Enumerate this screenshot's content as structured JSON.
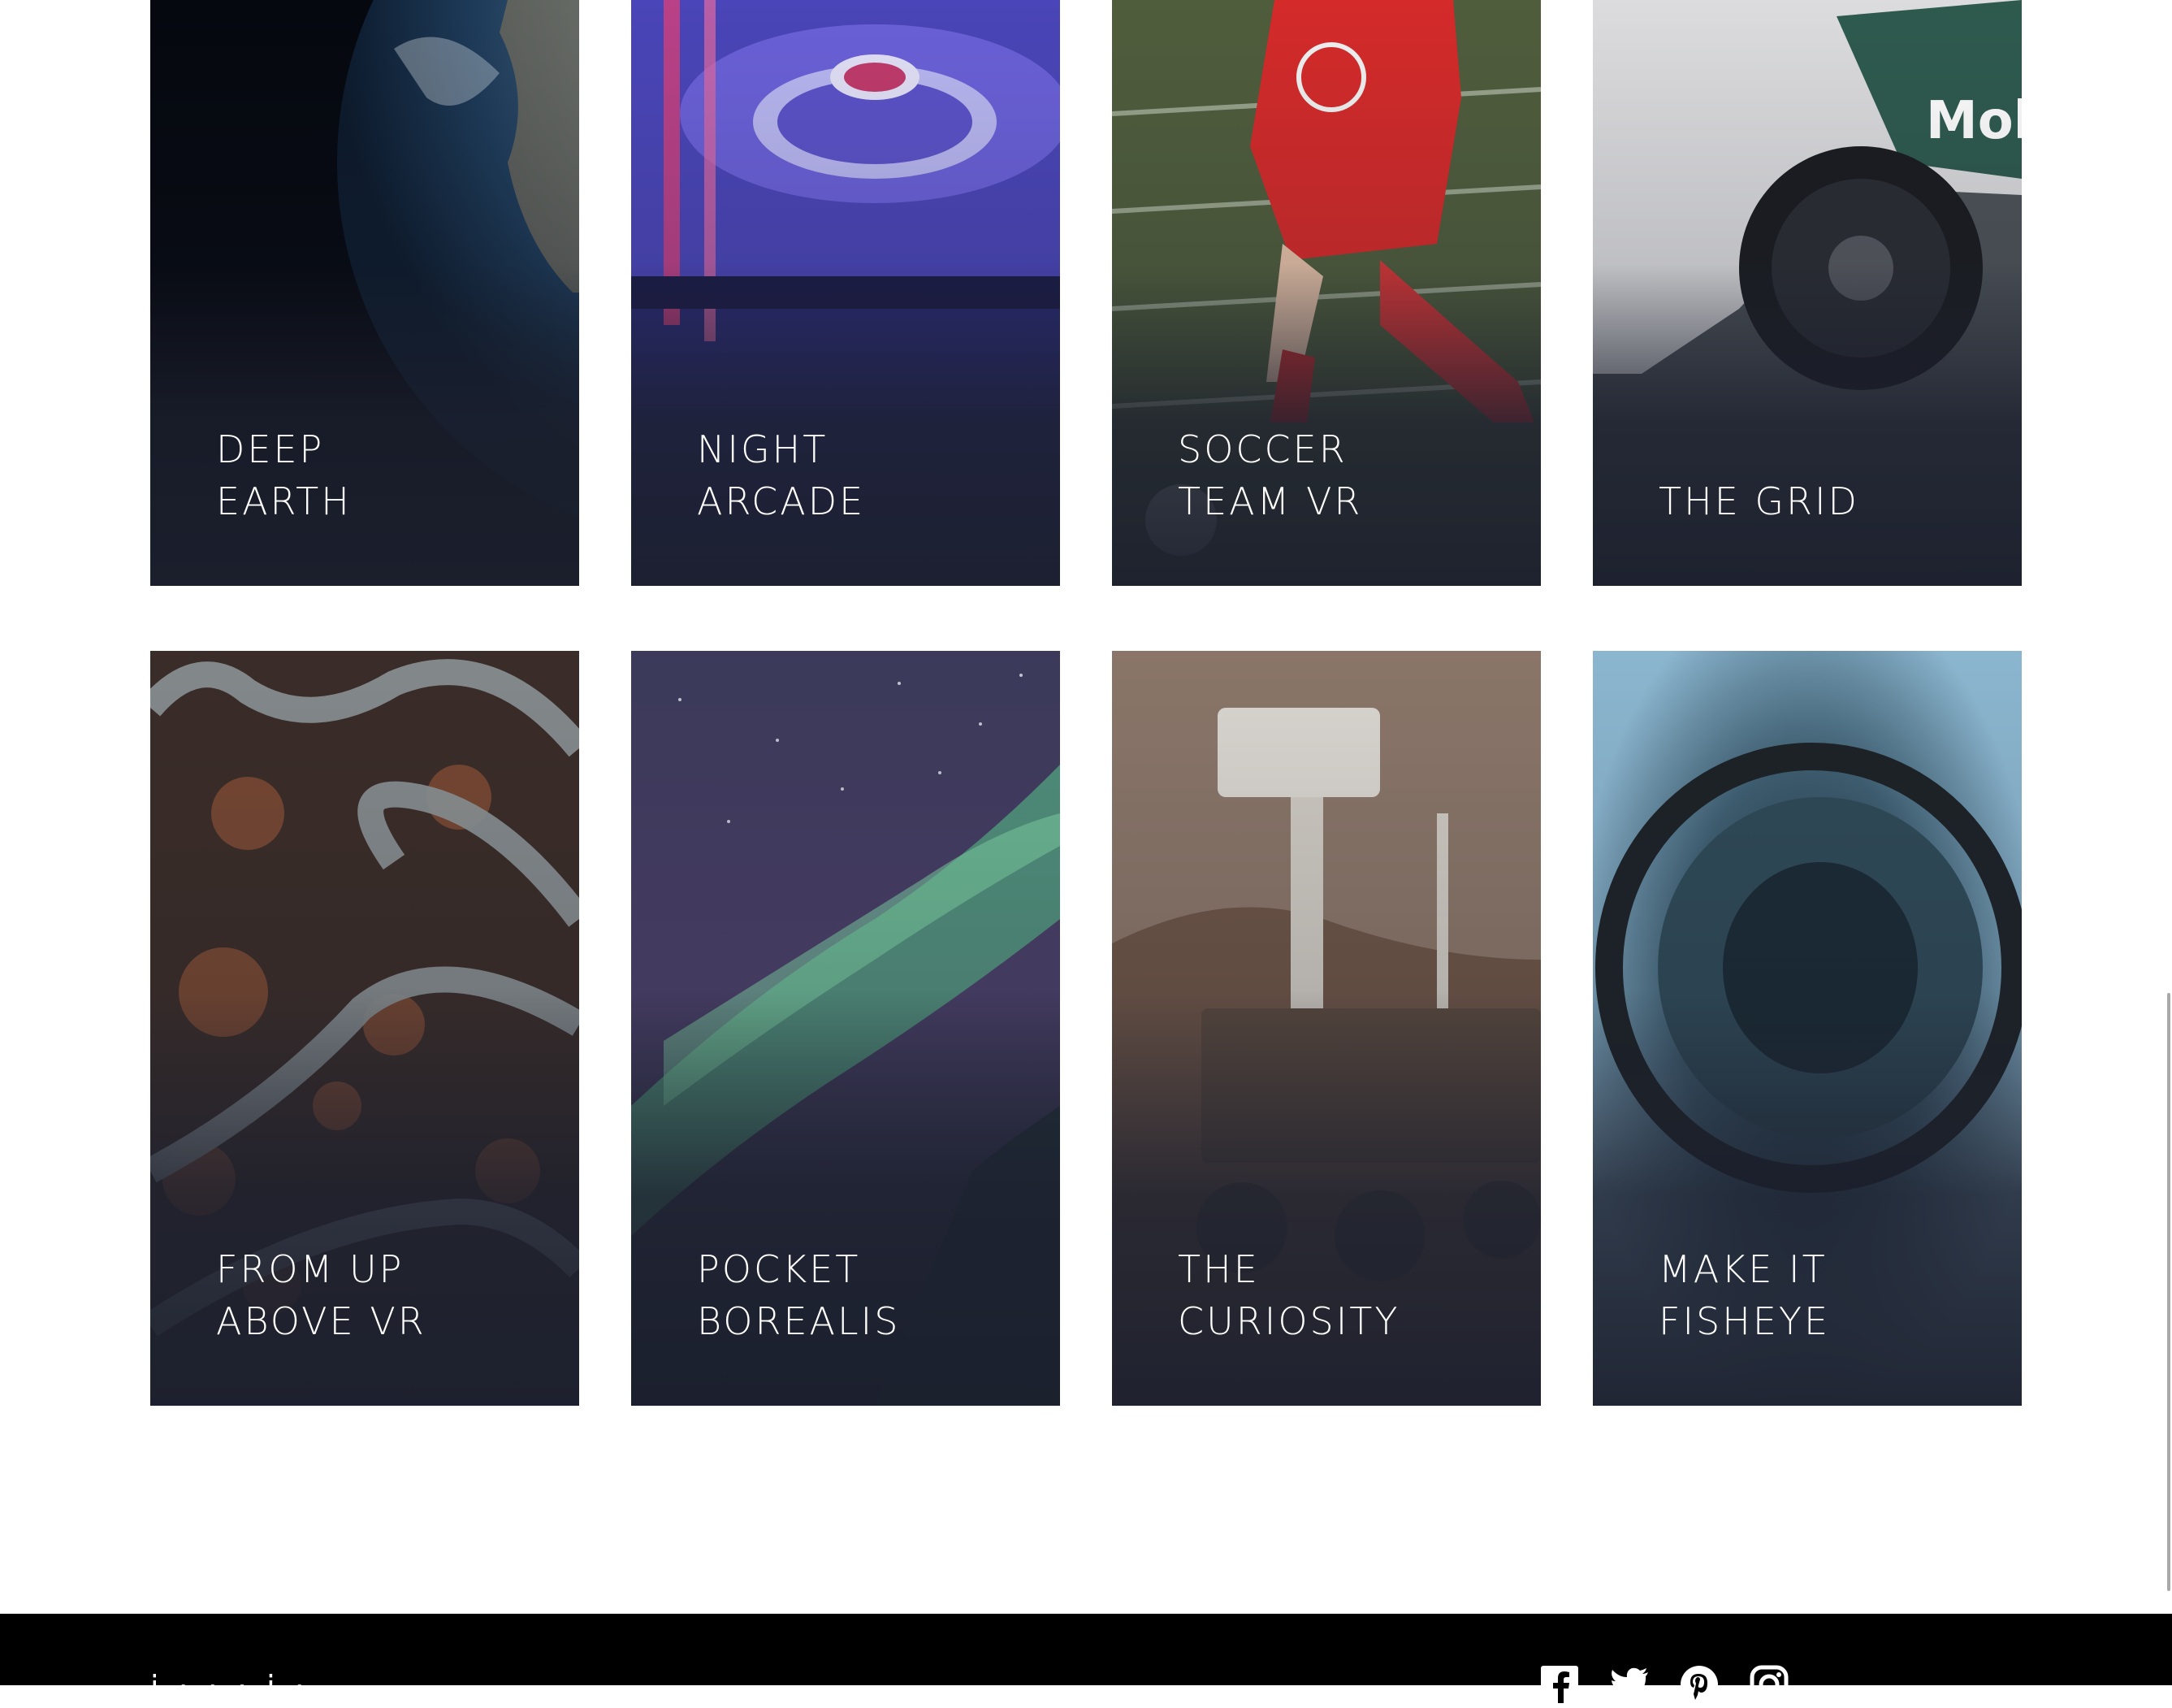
{
  "cards": [
    {
      "id": "deep-earth",
      "lines": [
        "DEEP",
        "EARTH"
      ]
    },
    {
      "id": "night-arcade",
      "lines": [
        "NIGHT",
        "ARCADE"
      ]
    },
    {
      "id": "soccer-team-vr",
      "lines": [
        "SOCCER",
        "TEAM VR"
      ]
    },
    {
      "id": "the-grid",
      "lines": [
        "",
        "THE GRID"
      ]
    },
    {
      "id": "from-up-above-vr",
      "lines": [
        "FROM UP",
        "ABOVE VR"
      ]
    },
    {
      "id": "pocket-borealis",
      "lines": [
        "POCKET",
        "BOREALIS"
      ]
    },
    {
      "id": "the-curiosity",
      "lines": [
        "THE",
        "CURIOSITY"
      ]
    },
    {
      "id": "make-it-fisheye",
      "lines": [
        "MAKE IT",
        "FISHEYE"
      ]
    }
  ],
  "footer": {
    "brand_partial": "i · · · i ·",
    "social_icons": [
      "facebook-icon",
      "twitter-icon",
      "pinterest-icon",
      "instagram-icon"
    ]
  },
  "colors": {
    "page_bg": "#ffffff",
    "card_overlay": "#1c2032",
    "footer_bg": "#000000",
    "label_text": "#ffffff"
  }
}
